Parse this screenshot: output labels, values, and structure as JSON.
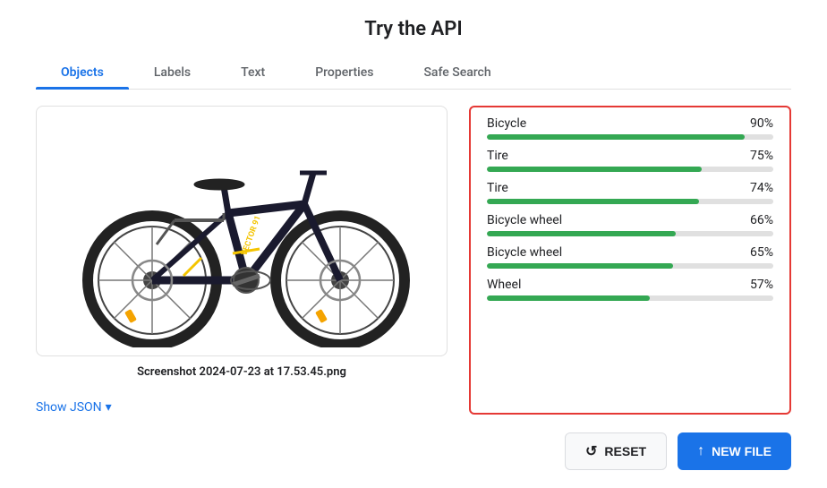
{
  "page": {
    "title": "Try the API"
  },
  "tabs": [
    {
      "id": "objects",
      "label": "Objects",
      "active": true
    },
    {
      "id": "labels",
      "label": "Labels",
      "active": false
    },
    {
      "id": "text",
      "label": "Text",
      "active": false
    },
    {
      "id": "properties",
      "label": "Properties",
      "active": false
    },
    {
      "id": "safe-search",
      "label": "Safe Search",
      "active": false
    }
  ],
  "image": {
    "caption": "Screenshot 2024-07-23 at 17.53.45.png",
    "show_json": "Show JSON"
  },
  "results": [
    {
      "label": "Bicycle",
      "percent": 90,
      "display": "90%"
    },
    {
      "label": "Tire",
      "percent": 75,
      "display": "75%"
    },
    {
      "label": "Tire",
      "percent": 74,
      "display": "74%"
    },
    {
      "label": "Bicycle wheel",
      "percent": 66,
      "display": "66%"
    },
    {
      "label": "Bicycle wheel",
      "percent": 65,
      "display": "65%"
    },
    {
      "label": "Wheel",
      "percent": 57,
      "display": "57%"
    }
  ],
  "buttons": {
    "reset": "RESET",
    "new_file": "NEW FILE"
  }
}
